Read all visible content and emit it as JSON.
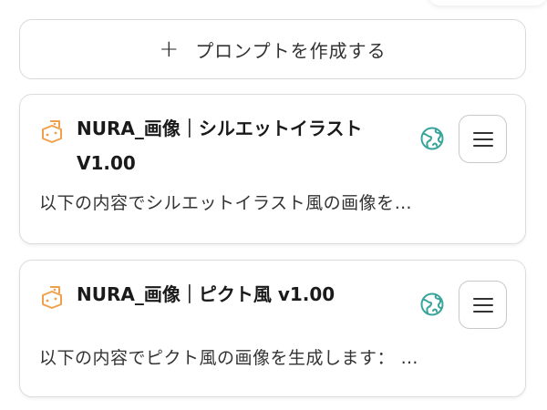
{
  "toolbar": {
    "create_prompt_plus": "+",
    "create_prompt_label": "プロンプトを作成する"
  },
  "prompts": [
    {
      "title_line1": "NURA_画像｜シルエットイラスト",
      "title_line2": "V1.00",
      "description": "以下の内容でシルエットイラスト風の画像を…",
      "visibility_icon": "globe-icon",
      "type_icon": "dice-icon",
      "menu_icon": "hamburger-menu-icon"
    },
    {
      "title_line1": "NURA_画像｜ピクト風 v1.00",
      "description": "以下の内容でピクト風の画像を生成します： …",
      "visibility_icon": "globe-icon",
      "type_icon": "dice-icon",
      "menu_icon": "hamburger-menu-icon"
    }
  ],
  "colors": {
    "dice_icon": "#f0a04b",
    "globe_icon": "#3aa59a",
    "border": "#d9d9d9"
  }
}
